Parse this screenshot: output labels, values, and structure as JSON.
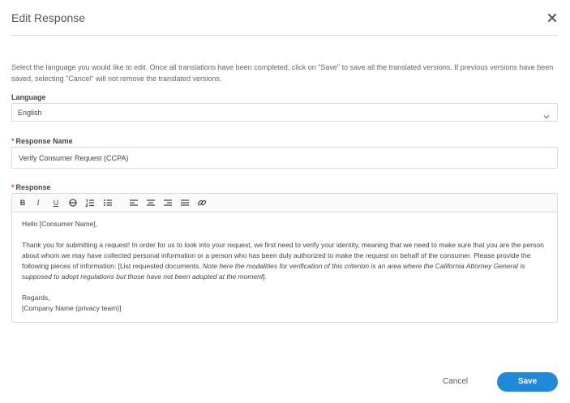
{
  "modal": {
    "title": "Edit Response",
    "close_icon": "close-icon"
  },
  "description": "Select the language you would like to edit. Once all translations have been completed, click on \"Save\" to save all the translated versions. If previous versions have been saved, selecting \"Cancel\" will not remove the translated versions.",
  "language": {
    "label": "Language",
    "value": "English",
    "icon": "chevron-down-icon"
  },
  "response_name": {
    "required_mark": "*",
    "label": "Response Name",
    "value": "Verify Consumer Request (CCPA)"
  },
  "response": {
    "required_mark": "*",
    "label": "Response",
    "toolbar": {
      "bold": "B",
      "italic": "I",
      "underline": "U",
      "icons": [
        "bold-icon",
        "italic-icon",
        "underline-icon",
        "strikethrough-icon",
        "ordered-list-icon",
        "bullet-list-icon",
        "align-left-icon",
        "align-center-icon",
        "align-right-icon",
        "align-justify-icon",
        "link-icon"
      ]
    },
    "body": {
      "greeting": "Hello [Consumer Name],",
      "paragraph_plain": "Thank you for submitting a request! In order for us to look into your request, we first need to verify your identity, meaning that we need to make sure that you are the person about whom we may have collected personal information or a person who has been duly authorized to make the request on behalf of the consumer. Please provide the following pieces of information: [List requested documents. ",
      "paragraph_italic": "Note here the modalities for verification of this criterion is an area where the California Attorney General is supposed to adopt regulations but those have not been adopted at the moment",
      "paragraph_end": "].",
      "closing": "Regards,",
      "signature": "[Company Name (privacy team)]"
    }
  },
  "footer": {
    "cancel_label": "Cancel",
    "save_label": "Save"
  },
  "colors": {
    "primary": "#1f8ad9",
    "required": "#d9534f",
    "border": "#d9d9d9"
  }
}
